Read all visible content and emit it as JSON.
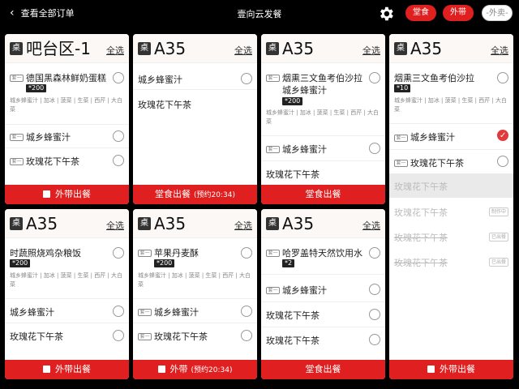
{
  "header": {
    "back_label": "查看全部订单",
    "title": "壹向云发餐",
    "pills": [
      "堂食",
      "外带",
      "-外卖-"
    ]
  },
  "select_all": "全选",
  "table_badge": "桌",
  "tag_label": "套一",
  "opts_text": "城乡蜂蜜汁 | 加冰 | 菠菜 | 生菜 | 西芹 | 大白菜",
  "cards": [
    {
      "table": "吧台区-1",
      "footer": "外带出餐",
      "footer_sub": ""
    },
    {
      "table": "A35",
      "footer": "堂食出餐",
      "footer_sub": "(预约20:34)"
    },
    {
      "table": "A35",
      "footer": "堂食出餐",
      "footer_sub": ""
    },
    {
      "table": "A35",
      "footer": "外带出餐",
      "footer_sub": ""
    },
    {
      "table": "A35",
      "footer": "外带出餐",
      "footer_sub": ""
    },
    {
      "table": "A35",
      "footer": "外带",
      "footer_sub": "(预约20:34)"
    },
    {
      "table": "A35",
      "footer": "堂食出餐",
      "footer_sub": ""
    }
  ],
  "items": {
    "c1_1": "德国黑森林鲜奶蛋糕",
    "c1_1q": "*200",
    "c1_2": "城乡蜂蜜汁",
    "c1_3": "玫瑰花下午茶",
    "c2_1": "城乡蜂蜜汁",
    "c2_2": "玫瑰花下午茶",
    "c3_1a": "烟熏三文鱼考伯沙拉",
    "c3_1b": "城乡蜂蜜汁",
    "c3_1q": "*200",
    "c3_2": "城乡蜂蜜汁",
    "c3_3": "玫瑰花下午茶",
    "c4_1": "烟熏三文鱼考伯沙拉",
    "c4_1q": "*10",
    "c4_2": "城乡蜂蜜汁",
    "c4_3": "玫瑰花下午茶",
    "c4_4": "玫瑰花下午茶",
    "c4_5": "玫瑰花下午茶",
    "c4_5s": "制作中",
    "c4_6": "玫瑰花下午茶",
    "c4_6s": "已出餐",
    "c4_7": "玫瑰花下午茶",
    "c4_7s": "已出餐",
    "c5_1": "时蔬照烧鸡杂粮饭",
    "c5_1q": "*200",
    "c5_2": "城乡蜂蜜汁",
    "c5_3": "玫瑰花下午茶",
    "c6_1": "苹果丹麦酥",
    "c6_1q": "*200",
    "c6_2": "城乡蜂蜜汁",
    "c6_3": "玫瑰花下午茶",
    "c7_1": "哈罗盖特天然饮用水",
    "c7_1q": "*2",
    "c7_2": "城乡蜂蜜汁",
    "c7_3": "玫瑰花下午茶",
    "c7_4": "玫瑰花下午茶"
  }
}
